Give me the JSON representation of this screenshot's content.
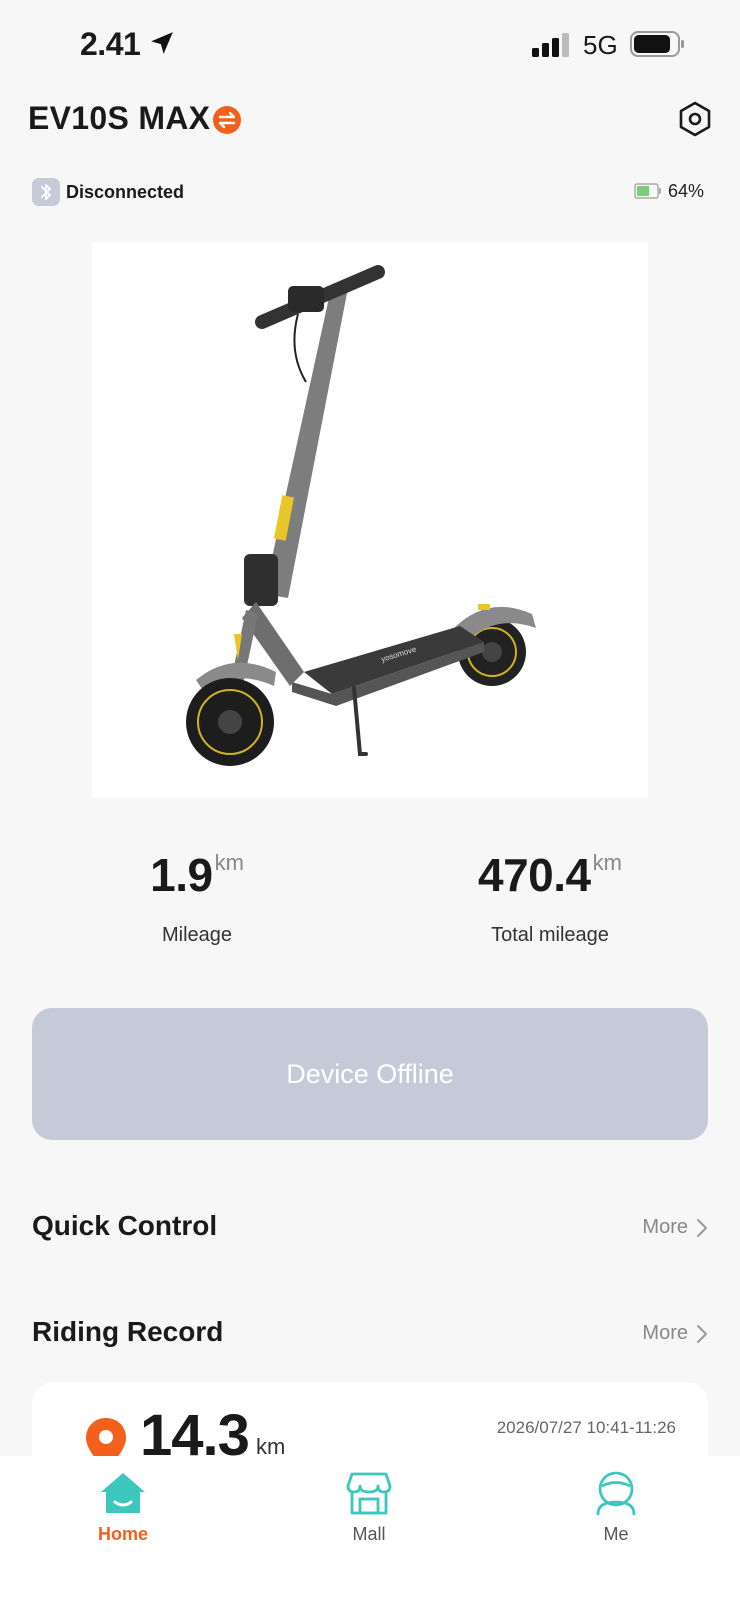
{
  "status_bar": {
    "time": "2.41",
    "network": "5G"
  },
  "header": {
    "title": "EV10S MAX",
    "switch_icon": "swap-icon",
    "settings_icon": "hexagon-settings-icon"
  },
  "connection": {
    "status": "Disconnected",
    "battery_percent": "64%",
    "battery_level": 0.64
  },
  "stats": [
    {
      "value": "1.9",
      "unit": "km",
      "label": "Mileage"
    },
    {
      "value": "470.4",
      "unit": "km",
      "label": "Total mileage"
    }
  ],
  "offline_button": {
    "label": "Device Offline"
  },
  "quick_control": {
    "title": "Quick Control",
    "more": "More"
  },
  "riding_record": {
    "title": "Riding Record",
    "more": "More",
    "latest": {
      "distance": "14.3",
      "unit": "km",
      "date": "2026/07/27 10:41-11:26"
    }
  },
  "tabs": [
    {
      "label": "Home",
      "icon": "home-icon",
      "active": true
    },
    {
      "label": "Mall",
      "icon": "store-icon",
      "active": false
    },
    {
      "label": "Me",
      "icon": "user-icon",
      "active": false
    }
  ],
  "colors": {
    "accent": "#f2601c",
    "teal": "#3cc7bd",
    "offline_bg": "#c5cad8",
    "background": "#f7f7f7"
  }
}
